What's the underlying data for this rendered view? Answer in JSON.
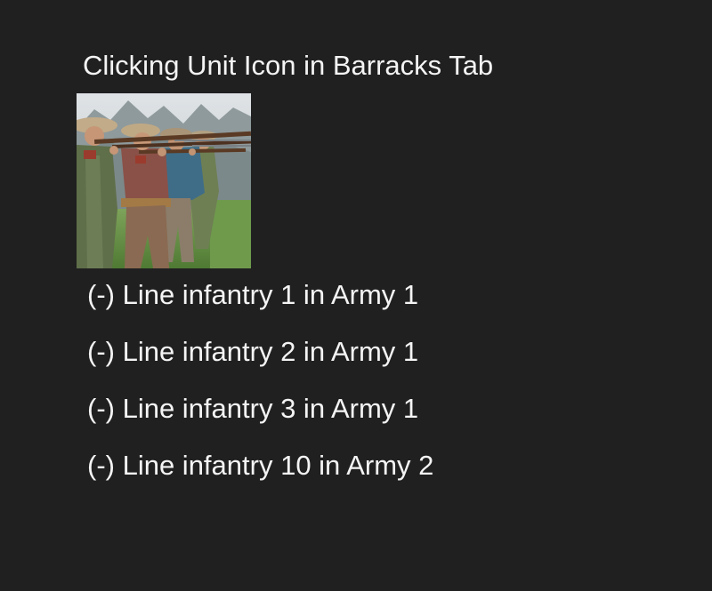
{
  "panel": {
    "title": "Clicking Unit Icon in Barracks Tab",
    "unit_icon": {
      "icon": "line-infantry-unit-portrait",
      "accent_colors": [
        "#c9cdd1",
        "#8e6a4c",
        "#5e7a4a",
        "#3f6d88"
      ]
    },
    "units": [
      {
        "label": "(-) Line infantry 1 in Army 1"
      },
      {
        "label": "(-) Line infantry 2 in Army 1"
      },
      {
        "label": "(-) Line infantry 3 in Army 1"
      },
      {
        "label": "(-) Line infantry 10 in Army 2"
      }
    ]
  }
}
